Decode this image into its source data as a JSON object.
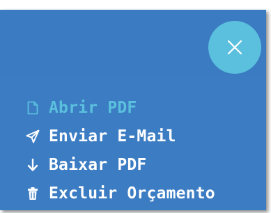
{
  "menu": {
    "close_icon": "close-icon",
    "items": [
      {
        "label": "Abrir PDF",
        "icon": "file-outline-icon",
        "active": true
      },
      {
        "label": "Enviar E-Mail",
        "icon": "paper-plane-icon",
        "active": false
      },
      {
        "label": "Baixar PDF",
        "icon": "arrow-down-icon",
        "active": false
      },
      {
        "label": "Excluir Orçamento",
        "icon": "trash-icon",
        "active": false
      }
    ]
  },
  "colors": {
    "panel": "#3b7cc3",
    "accent": "#5bc0de",
    "text": "#ffffff"
  }
}
